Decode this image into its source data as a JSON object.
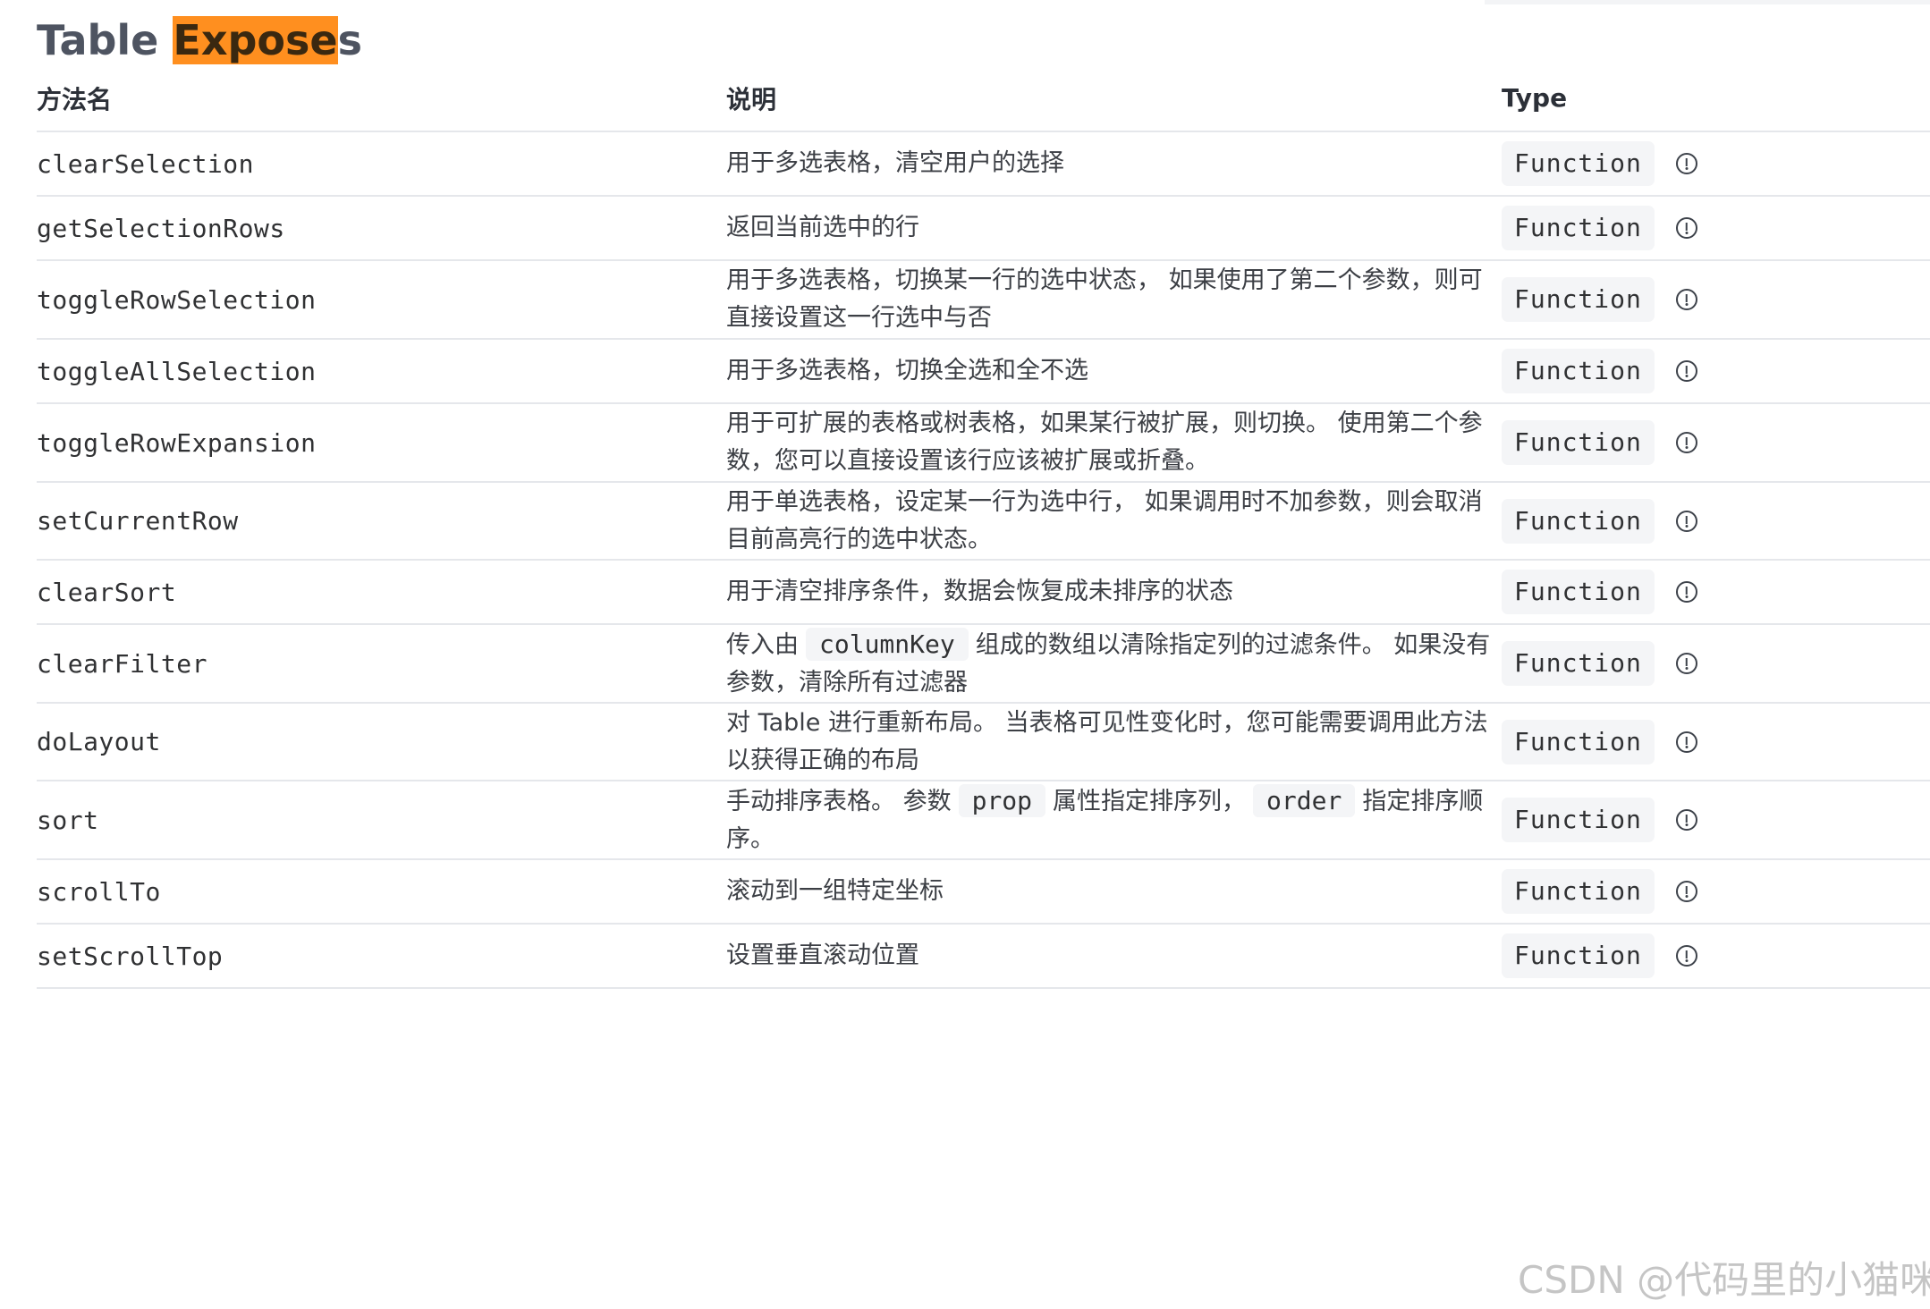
{
  "title": {
    "prefix": "Table ",
    "highlight": "Expose",
    "suffix": "s"
  },
  "columns": {
    "name": "方法名",
    "desc": "说明",
    "type": "Type"
  },
  "rows": [
    {
      "name": "clearSelection",
      "desc": "用于多选表格，清空用户的选择",
      "type": "Function"
    },
    {
      "name": "getSelectionRows",
      "desc": "返回当前选中的行",
      "type": "Function"
    },
    {
      "name": "toggleRowSelection",
      "desc": "用于多选表格，切换某一行的选中状态， 如果使用了第二个参数，则可直接设置这一行选中与否",
      "type": "Function"
    },
    {
      "name": "toggleAllSelection",
      "desc": "用于多选表格，切换全选和全不选",
      "type": "Function"
    },
    {
      "name": "toggleRowExpansion",
      "desc": "用于可扩展的表格或树表格，如果某行被扩展，则切换。 使用第二个参数，您可以直接设置该行应该被扩展或折叠。",
      "type": "Function"
    },
    {
      "name": "setCurrentRow",
      "desc": "用于单选表格，设定某一行为选中行， 如果调用时不加参数，则会取消目前高亮行的选中状态。",
      "type": "Function"
    },
    {
      "name": "clearSort",
      "desc": "用于清空排序条件，数据会恢复成未排序的状态",
      "type": "Function"
    },
    {
      "name": "clearFilter",
      "desc_parts": [
        "传入由",
        "columnKey",
        "组成的数组以清除指定列的过滤条件。 如果没有参数，清除所有过滤器"
      ],
      "type": "Function"
    },
    {
      "name": "doLayout",
      "desc": "对 Table 进行重新布局。 当表格可见性变化时，您可能需要调用此方法以获得正确的布局",
      "type": "Function"
    },
    {
      "name": "sort",
      "desc_parts": [
        "手动排序表格。 参数",
        "prop",
        "属性指定排序列，",
        "order",
        "指定排序顺序。"
      ],
      "type": "Function"
    },
    {
      "name": "scrollTo",
      "desc": "滚动到一组特定坐标",
      "type": "Function"
    },
    {
      "name": "setScrollTop",
      "desc": "设置垂直滚动位置",
      "type": "Function"
    }
  ],
  "watermark": "CSDN @代码里的小猫咪",
  "icons": {
    "type_info": "info-circle-icon"
  }
}
